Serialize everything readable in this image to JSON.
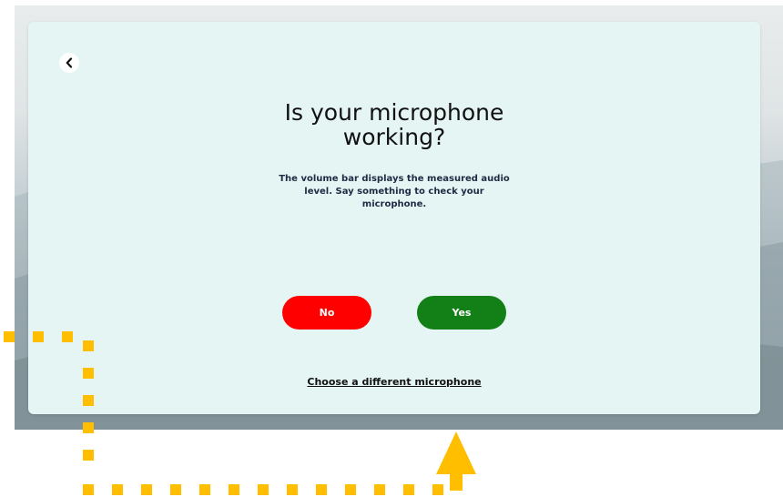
{
  "dialog": {
    "title": "Is your microphone working?",
    "description": "The volume bar displays the measured audio level. Say something to check your microphone.",
    "no_label": "No",
    "yes_label": "Yes",
    "change_mic_label": "Choose a different microphone"
  },
  "colors": {
    "dialog_background": "#e4f5f3",
    "no_button": "#ff0000",
    "yes_button": "#138017",
    "annotation": "#ffbe00"
  },
  "icons": {
    "back": "chevron-left-icon",
    "annotation": "arrow-up-icon"
  }
}
